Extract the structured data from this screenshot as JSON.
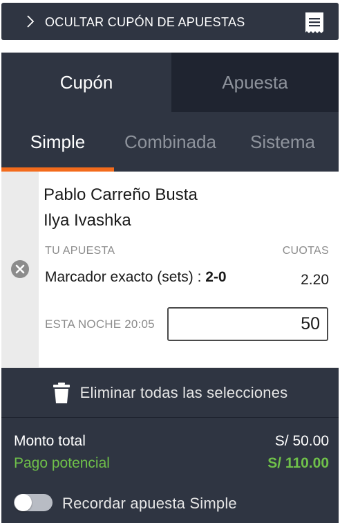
{
  "header": {
    "toggle_label": "OCULTAR CUPÓN DE APUESTAS",
    "chevron_icon": "chevron-right-icon",
    "receipt_icon": "receipt-icon"
  },
  "main_tabs": [
    {
      "label": "Cupón",
      "active": true
    },
    {
      "label": "Apuesta",
      "active": false
    }
  ],
  "sub_tabs": [
    {
      "label": "Simple",
      "active": true
    },
    {
      "label": "Combinada",
      "active": false
    },
    {
      "label": "Sistema",
      "active": false
    }
  ],
  "selection": {
    "player1": "Pablo Carreño Busta",
    "player2": "Ilya Ivashka",
    "your_bet_label": "TU APUESTA",
    "odds_label": "CUOTAS",
    "market": "Marcador exacto (sets) : ",
    "pick": "2-0",
    "odds": "2.20",
    "event_time": "ESTA NOCHE 20:05",
    "stake": "50",
    "remove_icon": "close-circle-icon"
  },
  "footer": {
    "delete_all_label": "Eliminar todas las selecciones",
    "delete_icon": "trash-icon",
    "total_label": "Monto total",
    "total_value": "S/ 50.00",
    "potential_label": "Pago potencial",
    "potential_value": "S/ 110.00",
    "remember_label": "Recordar apuesta Simple",
    "remember_enabled": false
  },
  "colors": {
    "panel": "#2f3542",
    "panel_dark": "#1f2430",
    "accent": "#f36b1c",
    "positive": "#6fc04a"
  }
}
